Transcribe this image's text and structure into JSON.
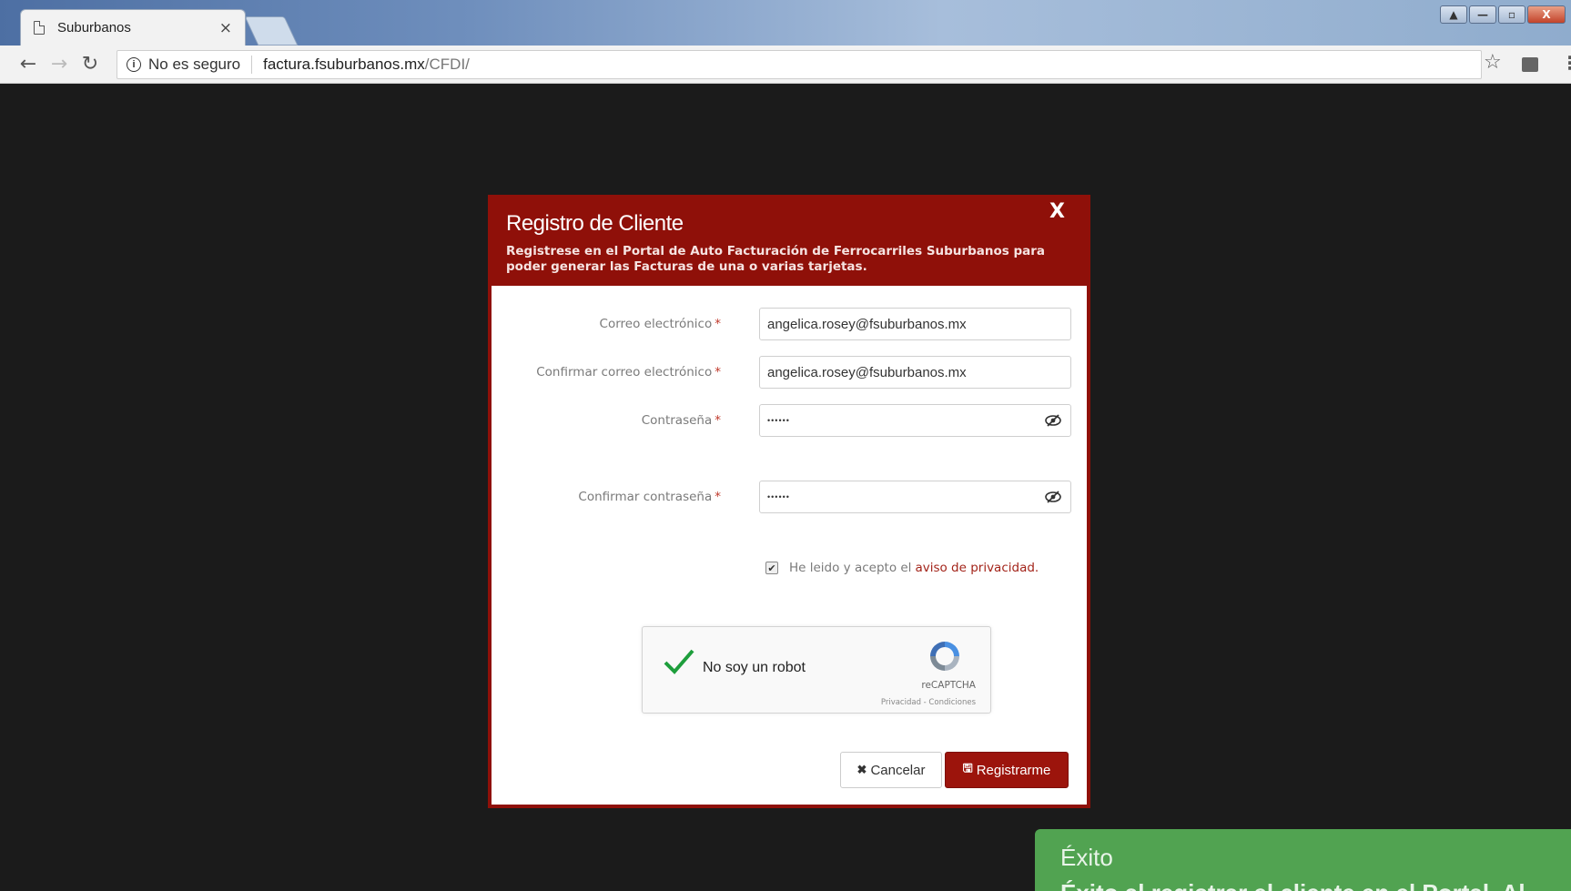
{
  "browser": {
    "tab_title": "Suburbanos",
    "tab_close": "×",
    "security_label": "No es seguro",
    "url_host": "factura.fsuburbanos.mx",
    "url_path": "/CFDI/",
    "window_buttons": [
      "▲",
      "—",
      "▫",
      "X"
    ]
  },
  "modal": {
    "title": "Registro de Cliente",
    "subtitle": "Registrese en el Portal de Auto Facturación de Ferrocarriles Suburbanos para poder generar las Facturas de una o varias tarjetas.",
    "close_label": "X",
    "fields": {
      "email_label": "Correo electrónico",
      "email_value": "angelica.rosey@fsuburbanos.mx",
      "confirm_email_label": "Confirmar correo electrónico",
      "confirm_email_value": "angelica.rosey@fsuburbanos.mx",
      "password_label": "Contraseña",
      "password_value": "••••••",
      "confirm_password_label": "Confirmar contraseña",
      "confirm_password_value": "••••••",
      "required_mark": "*"
    },
    "privacy": {
      "checked": true,
      "text": "He leido y acepto el",
      "link": "aviso de privacidad."
    },
    "recaptcha": {
      "label": "No soy un robot",
      "brand": "reCAPTCHA",
      "terms": "Privacidad - Condiciones",
      "checked": true
    },
    "buttons": {
      "cancel": "Cancelar",
      "register": "Registrarme"
    }
  },
  "toast": {
    "title": "Éxito",
    "message": "Éxito al registrar el cliente en el Portal. Al"
  },
  "colors": {
    "modal_red": "#8f1009",
    "button_red": "#9c140c",
    "toast_green": "#51a351",
    "backdrop": "#1b1b1b"
  }
}
